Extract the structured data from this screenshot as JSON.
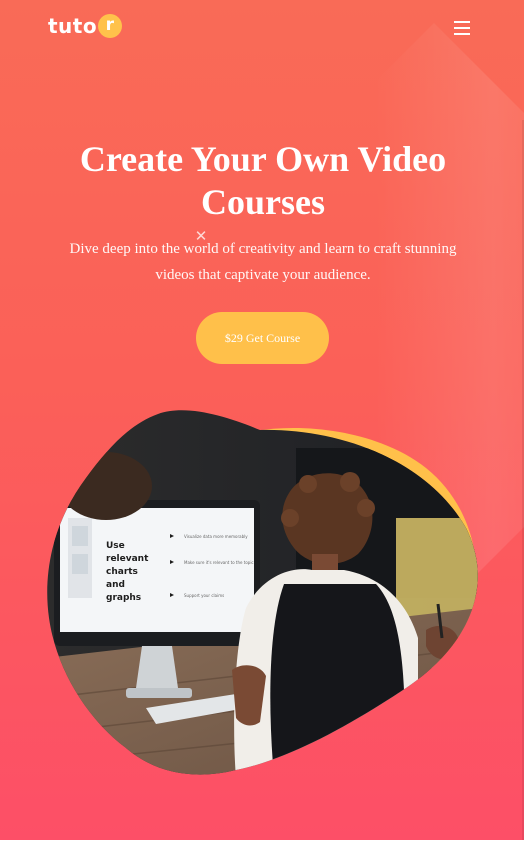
{
  "header": {
    "logo_text": "tuto",
    "logo_dot_letter": "r",
    "menu_icon": "hamburger-menu-icon"
  },
  "hero": {
    "title": "Create Your Own Video Courses",
    "subtitle": "Dive deep into the world of creativity and learn to craft stunning videos that captivate your audience.",
    "close_symbol": "✕",
    "cta_label": "$29 Get Course"
  },
  "hero_image": {
    "screen_heading": "Use relevant charts and graphs",
    "screen_bullets": [
      "Visualize data more memorably",
      "Make sure it's relevant to the topic",
      "Support your claims"
    ]
  },
  "colors": {
    "gradient_top": "#f96b57",
    "gradient_bottom": "#fd4f67",
    "accent_yellow": "#ffc04a",
    "text": "#ffffff"
  }
}
